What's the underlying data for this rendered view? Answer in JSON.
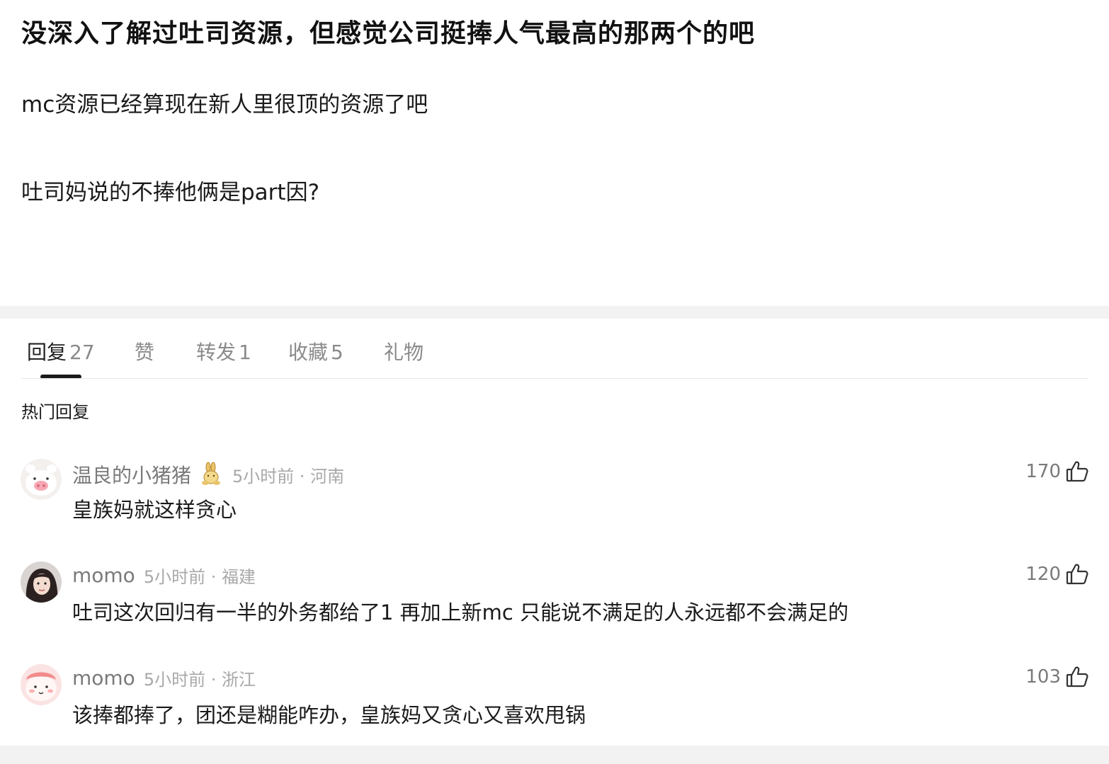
{
  "post": {
    "title": "没深入了解过吐司资源，但感觉公司挺捧人气最高的那两个的吧",
    "lines": [
      "mc资源已经算现在新人里很顶的资源了吧",
      "吐司妈说的不捧他俩是part因?"
    ]
  },
  "tabs": [
    {
      "label": "回复",
      "count": "27",
      "active": true
    },
    {
      "label": "赞",
      "count": ""
    },
    {
      "label": "转发",
      "count": "1"
    },
    {
      "label": "收藏",
      "count": "5"
    },
    {
      "label": "礼物",
      "count": ""
    }
  ],
  "section_title": "热门回复",
  "comments": [
    {
      "username": "温良的小猪猪",
      "badge_icon": "rabbit-badge-icon",
      "time_location": "5小时前 · 河南",
      "text": "皇族妈就这样贪心",
      "likes": "170",
      "avatar_icon": "pig-avatar"
    },
    {
      "username": "momo",
      "time_location": "5小时前 · 福建",
      "text": "吐司这次回归有一半的外务都给了1 再加上新mc 只能说不满足的人永远都不会满足的",
      "likes": "120",
      "avatar_icon": "girl-photo-avatar"
    },
    {
      "username": "momo",
      "time_location": "5小时前 · 浙江",
      "text": "该捧都捧了，团还是糊能咋办，皇族妈又贪心又喜欢甩锅",
      "likes": "103",
      "avatar_icon": "pink-cartoon-avatar"
    }
  ],
  "colors": {
    "text_primary": "#1a1a1a",
    "text_secondary": "#7a7a7a",
    "text_tertiary": "#a8a8a8",
    "band": "#f2f2f2"
  }
}
